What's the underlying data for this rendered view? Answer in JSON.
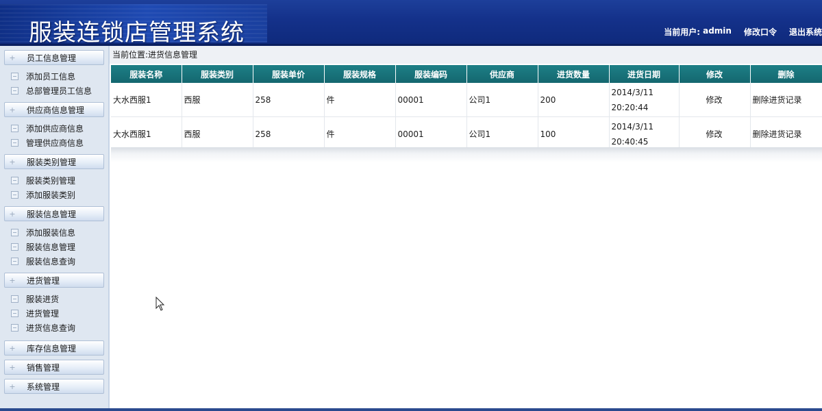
{
  "header": {
    "title": "服装连锁店管理系统",
    "current_user_label": "当前用户:",
    "current_user": "admin",
    "change_password": "修改口令",
    "logout": "退出系统"
  },
  "sidebar": {
    "groups": [
      {
        "label": "员工信息管理",
        "items": [
          "添加员工信息",
          "总部管理员工信息"
        ]
      },
      {
        "label": "供应商信息管理",
        "items": [
          "添加供应商信息",
          "管理供应商信息"
        ]
      },
      {
        "label": "服装类别管理",
        "items": [
          "服装类别管理",
          "添加服装类别"
        ]
      },
      {
        "label": "服装信息管理",
        "items": [
          "添加服装信息",
          "服装信息管理",
          "服装信息查询"
        ]
      },
      {
        "label": "进货管理",
        "items": [
          "服装进货",
          "进货管理",
          "进货信息查询"
        ]
      },
      {
        "label": "库存信息管理",
        "items": []
      },
      {
        "label": "销售管理",
        "items": []
      },
      {
        "label": "系统管理",
        "items": []
      }
    ]
  },
  "breadcrumb": {
    "prefix": "当前位置:",
    "page": "进货信息管理"
  },
  "table": {
    "columns": [
      "服装名称",
      "服装类别",
      "服装单价",
      "服装规格",
      "服装编码",
      "供应商",
      "进货数量",
      "进货日期",
      "修改",
      "删除"
    ],
    "rows": [
      {
        "name": "大水西服1",
        "category": "西服",
        "price": "258",
        "spec": "件",
        "code": "00001",
        "supplier": "公司1",
        "quantity": "200",
        "date": "2014/3/11",
        "time": "20:20:44",
        "edit": "修改",
        "delete": "删除进货记录"
      },
      {
        "name": "大水西服1",
        "category": "西服",
        "price": "258",
        "spec": "件",
        "code": "00001",
        "supplier": "公司1",
        "quantity": "100",
        "date": "2014/3/11",
        "time": "20:40:45",
        "edit": "修改",
        "delete": "删除进货记录"
      }
    ]
  },
  "icons": {
    "menu_group": "plus-icon",
    "menu_item": "box-icon",
    "pointer": "mouse-cursor-icon"
  },
  "colors": {
    "header_bg": "#14318a",
    "table_header_bg": "#14676f",
    "sidebar_bg": "#dfe7f1"
  }
}
